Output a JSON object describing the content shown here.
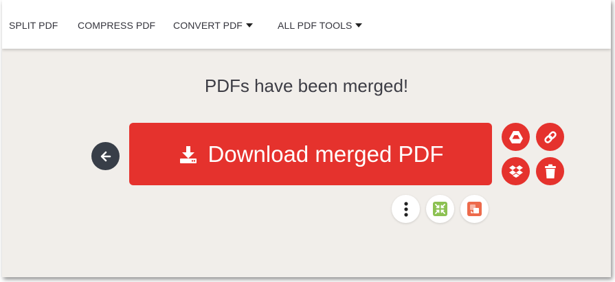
{
  "nav": {
    "items": [
      {
        "label": "SPLIT PDF",
        "has_dropdown": false
      },
      {
        "label": "COMPRESS PDF",
        "has_dropdown": false
      },
      {
        "label": "CONVERT PDF",
        "has_dropdown": true
      },
      {
        "label": "ALL PDF TOOLS",
        "has_dropdown": true
      }
    ]
  },
  "main": {
    "headline": "PDFs have been merged!",
    "download_label": "Download merged PDF",
    "icons": {
      "back": "arrow-left-icon",
      "download": "download-icon",
      "google_drive": "google-drive-icon",
      "link": "link-icon",
      "dropbox": "dropbox-icon",
      "delete": "trash-icon",
      "more": "more-vertical-icon",
      "compress": "compress-icon",
      "convert": "convert-icon"
    }
  },
  "colors": {
    "brand_red": "#e5322d",
    "back_button": "#383e48",
    "background": "#f1eeea",
    "compress_green": "#8cc152",
    "convert_orange": "#ed6a4b"
  }
}
